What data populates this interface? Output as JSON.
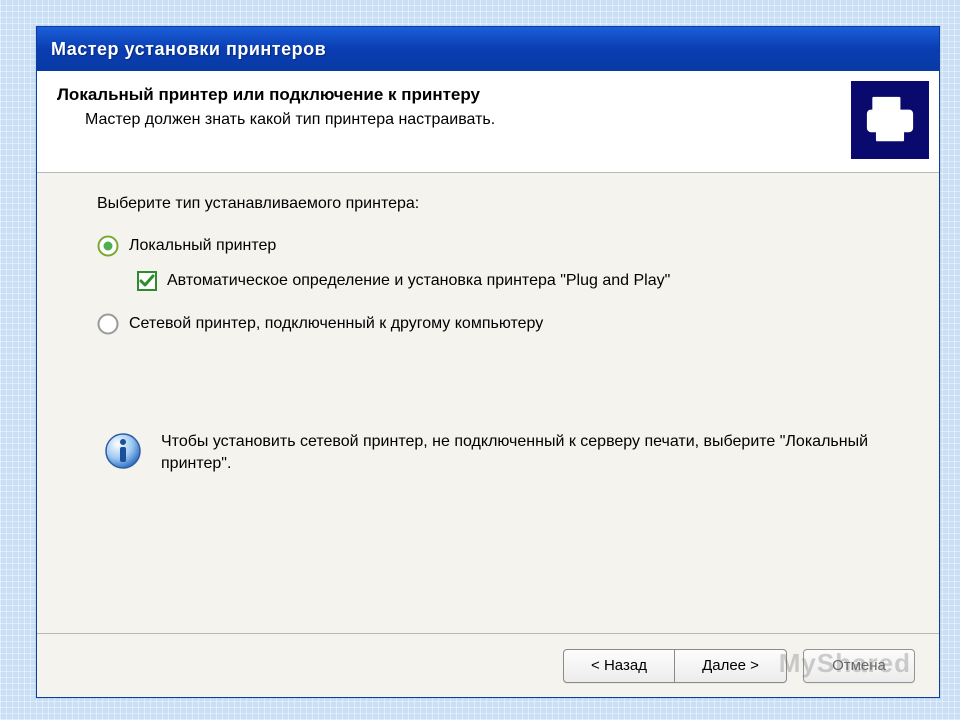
{
  "window": {
    "title": "Мастер установки принтеров"
  },
  "header": {
    "title": "Локальный принтер или подключение к принтеру",
    "subtitle": "Мастер должен знать какой тип принтера настраивать.",
    "icon": "printer-icon"
  },
  "content": {
    "instruction": "Выберите тип устанавливаемого принтера:",
    "option_local": {
      "label": "Локальный принтер",
      "selected": true
    },
    "checkbox_pnp": {
      "label": "Автоматическое определение и установка принтера \"Plug and Play\"",
      "checked": true
    },
    "option_network": {
      "label": "Сетевой принтер, подключенный к другому компьютеру",
      "selected": false
    },
    "info": {
      "text": "Чтобы установить сетевой принтер, не подключенный к серверу печати, выберите \"Локальный принтер\"."
    }
  },
  "footer": {
    "back": "< Назад",
    "next": "Далее >",
    "cancel": "Отмена"
  },
  "watermark": "MyShared",
  "colors": {
    "titlebar": "#0a3db2",
    "icon_bg": "#0a0a6e",
    "accent_green": "#4caf50"
  }
}
